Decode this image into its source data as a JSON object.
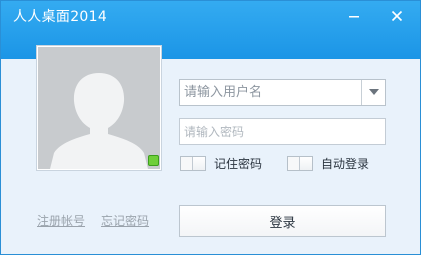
{
  "window": {
    "title": "人人桌面2014",
    "controls": [
      "minimize-icon",
      "close-icon"
    ],
    "accent_color": "#1b95e6"
  },
  "avatar": {
    "icon": "default-user-silhouette",
    "status": "online",
    "status_color": "#6fcf3a"
  },
  "login_form": {
    "username_placeholder": "请输入用户名",
    "username_value": "",
    "password_placeholder": "请输入密码",
    "password_value": "",
    "remember_password_label": "记住密码",
    "remember_password_checked": false,
    "auto_login_label": "自动登录",
    "auto_login_checked": false,
    "login_button_label": "登录"
  },
  "links": {
    "register": "注册帐号",
    "forgot_password": "忘记密码"
  }
}
